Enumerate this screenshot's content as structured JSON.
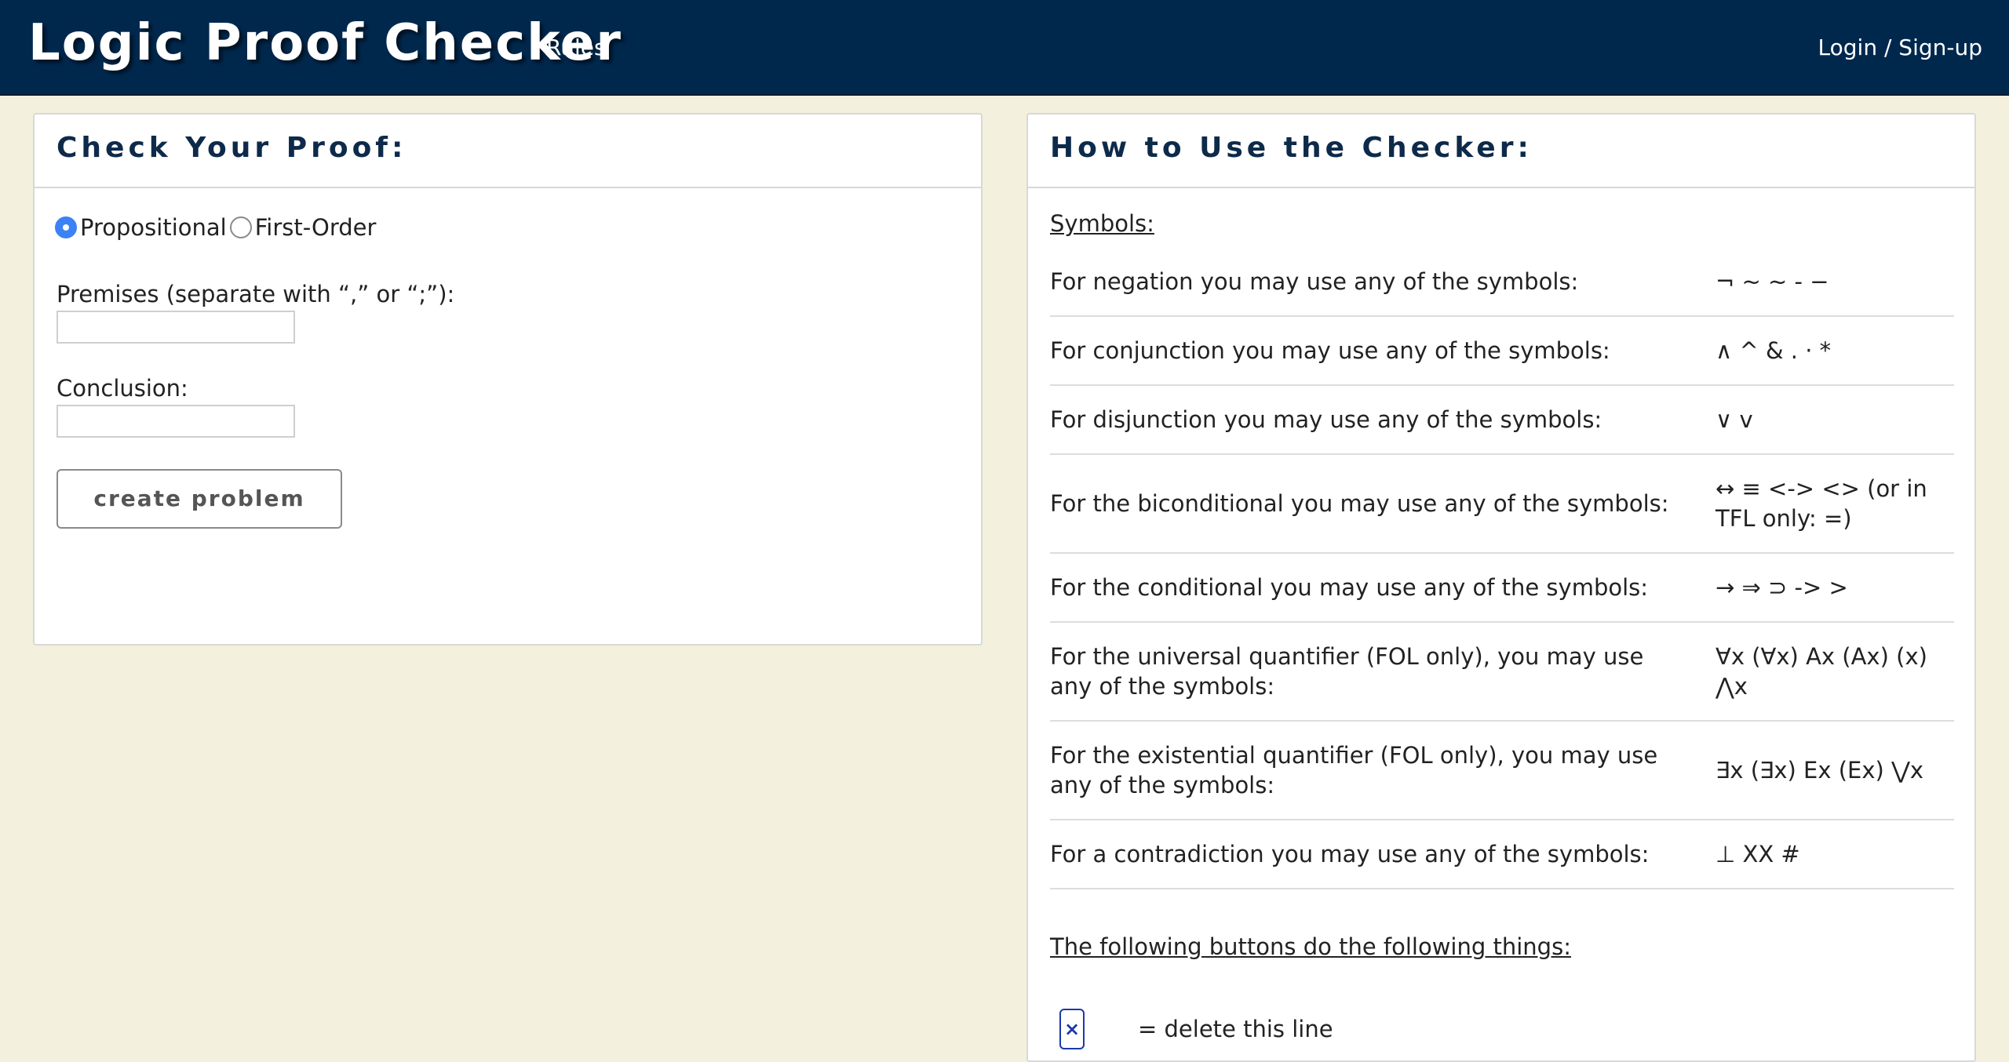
{
  "header": {
    "brand": "Logic Proof Checker",
    "nav_rules": "Rules",
    "nav_login": "Login / Sign-up"
  },
  "check_panel": {
    "title": "Check Your Proof:",
    "radio_options": [
      {
        "label": "Propositional",
        "checked": true
      },
      {
        "label": "First-Order",
        "checked": false
      }
    ],
    "premises_label": "Premises (separate with “,” or “;”):",
    "premises_value": "",
    "conclusion_label": "Conclusion:",
    "conclusion_value": "",
    "create_button": "create problem"
  },
  "help_panel": {
    "title": "How to Use the Checker:",
    "symbols_heading": "Symbols:",
    "symbols": [
      {
        "desc": "For negation you may use any of the symbols:",
        "value": "¬ ~ ∼ - −"
      },
      {
        "desc": "For conjunction you may use any of the symbols:",
        "value": "∧ ^ & . · *"
      },
      {
        "desc": "For disjunction you may use any of the symbols:",
        "value": "∨ v"
      },
      {
        "desc": "For the biconditional you may use any of the symbols:",
        "value": "↔ ≡ <-> <> (or in TFL only: =)"
      },
      {
        "desc": "For the conditional you may use any of the symbols:",
        "value": "→ ⇒ ⊃ -> >"
      },
      {
        "desc": "For the universal quantifier (FOL only), you may use any of the symbols:",
        "value": "∀x (∀x) Ax (Ax) (x) ⋀x"
      },
      {
        "desc": "For the existential quantifier (FOL only), you may use any of the symbols:",
        "value": "∃x (∃x) Ex (Ex) ⋁x"
      },
      {
        "desc": "For a contradiction you may use any of the symbols:",
        "value": "⊥ XX #"
      }
    ],
    "buttons_heading": "The following buttons do the following things:",
    "delete_button_glyph": "×",
    "delete_button_desc": "= delete this line"
  }
}
